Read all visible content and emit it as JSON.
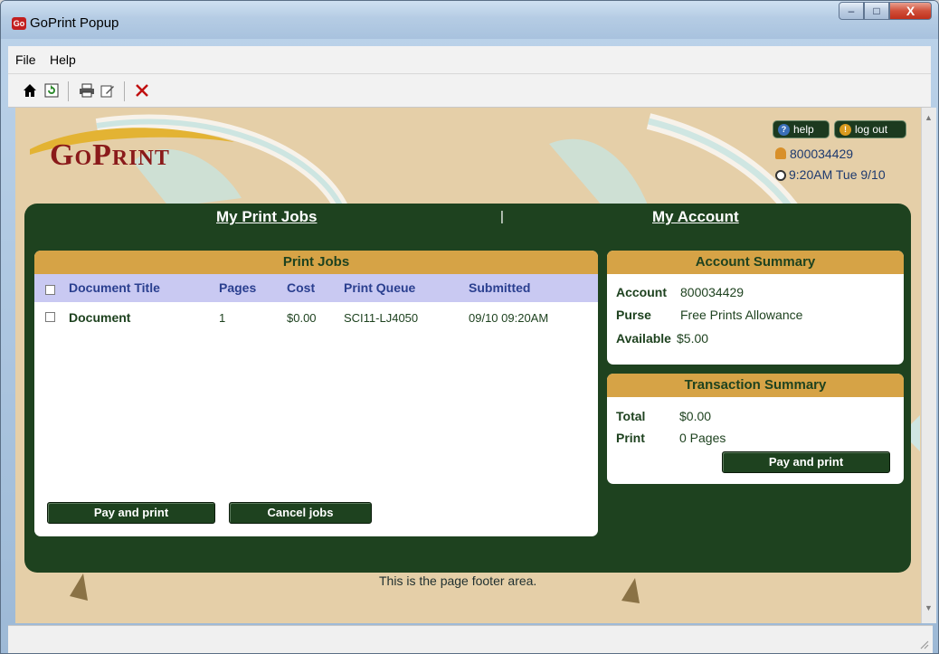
{
  "window": {
    "title": "GoPrint Popup",
    "app_icon": "Go",
    "controls": {
      "minimize": "–",
      "maximize": "□",
      "close": "X"
    }
  },
  "menu": {
    "items": [
      "File",
      "Help"
    ]
  },
  "toolbar": {
    "icons": [
      "home-icon",
      "refresh-icon",
      "print-icon",
      "edit-icon",
      "delete-icon"
    ]
  },
  "header": {
    "logo": "GoPrint",
    "help_label": "help",
    "logout_label": "log out",
    "user_id": "800034429",
    "datetime": "9:20AM Tue 9/10"
  },
  "nav": {
    "print_jobs": "My Print Jobs",
    "separator": "|",
    "account": "My Account"
  },
  "print_jobs": {
    "heading": "Print Jobs",
    "columns": [
      "Document Title",
      "Pages",
      "Cost",
      "Print Queue",
      "Submitted"
    ],
    "rows": [
      {
        "title": "Document",
        "pages": "1",
        "cost": "$0.00",
        "queue": "SCI11-LJ4050",
        "submitted": "09/10 09:20AM"
      }
    ],
    "pay_button": "Pay and print",
    "cancel_button": "Cancel jobs"
  },
  "account_summary": {
    "heading": "Account Summary",
    "account_label": "Account",
    "account_value": "800034429",
    "purse_label": "Purse",
    "purse_value": "Free Prints Allowance",
    "available_label": "Available",
    "available_value": "$5.00"
  },
  "transaction_summary": {
    "heading": "Transaction Summary",
    "total_label": "Total",
    "total_value": "$0.00",
    "print_label": "Print",
    "print_value": "0 Pages",
    "pay_button": "Pay and print"
  },
  "footer": {
    "text": "This is the page footer area."
  },
  "colors": {
    "brand_green": "#1e421f",
    "header_gold": "#d6a346",
    "background_tan": "#e5cfa8"
  }
}
